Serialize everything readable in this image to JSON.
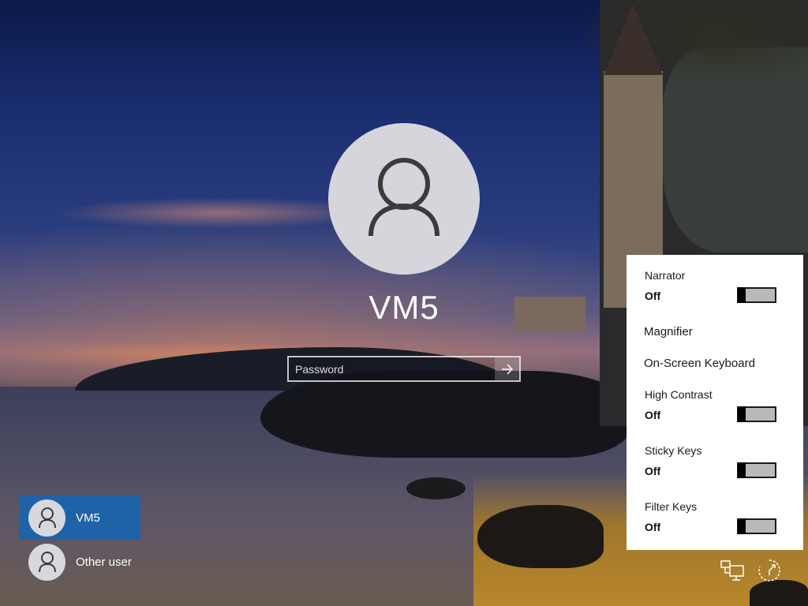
{
  "user": {
    "name": "VM5"
  },
  "password": {
    "placeholder": "Password",
    "value": ""
  },
  "user_list": [
    {
      "label": "VM5",
      "selected": true
    },
    {
      "label": "Other user",
      "selected": false
    }
  ],
  "ease_of_access": {
    "narrator": {
      "label": "Narrator",
      "state": "Off"
    },
    "magnifier": {
      "label": "Magnifier"
    },
    "on_screen_keyboard": {
      "label": "On-Screen Keyboard"
    },
    "high_contrast": {
      "label": "High Contrast",
      "state": "Off"
    },
    "sticky_keys": {
      "label": "Sticky Keys",
      "state": "Off"
    },
    "filter_keys": {
      "label": "Filter Keys",
      "state": "Off"
    }
  },
  "icons": {
    "avatar": "person-icon",
    "submit": "arrow-right-icon",
    "network": "network-icon",
    "ease": "ease-of-access-icon"
  },
  "colors": {
    "selected_tile": "#1e62a8",
    "panel_bg": "#ffffff"
  }
}
